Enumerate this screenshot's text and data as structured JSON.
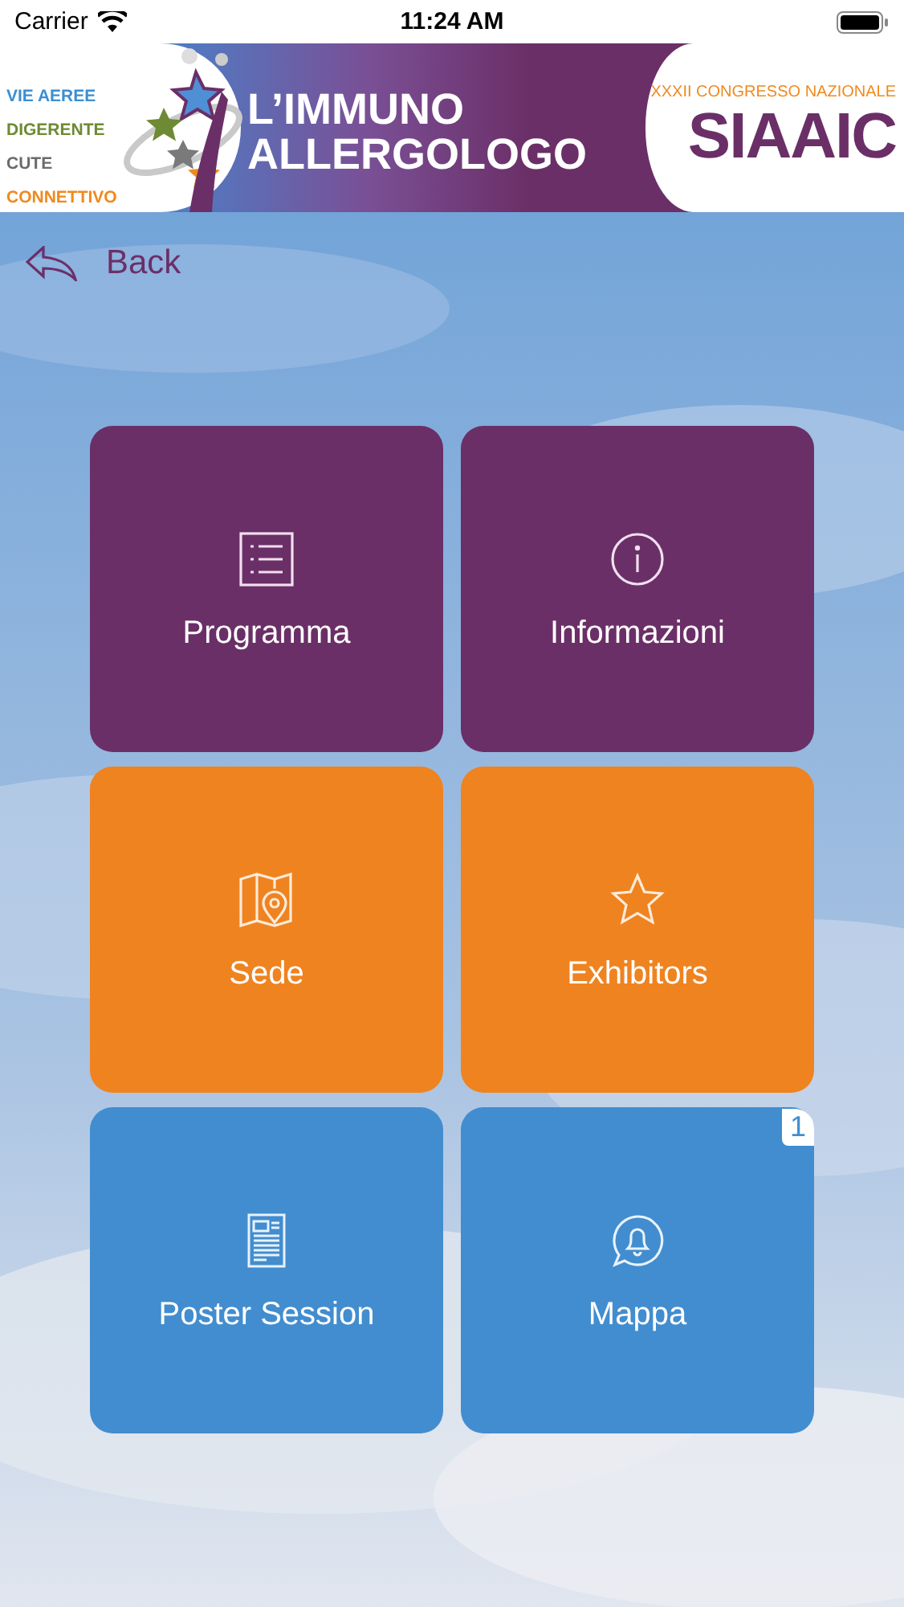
{
  "status_bar": {
    "carrier": "Carrier",
    "time": "11:24 AM"
  },
  "banner": {
    "topics": [
      {
        "label": "VIE AEREE",
        "color": "#3b8fd2"
      },
      {
        "label": "DIGERENTE",
        "color": "#6f8a34"
      },
      {
        "label": "CUTE",
        "color": "#6b6b6b"
      },
      {
        "label": "CONNETTIVO",
        "color": "#ef8a1e"
      }
    ],
    "title_lines": [
      "L’IMMUNO",
      "ALLERGOLOGO"
    ],
    "subtitle": "XXXII CONGRESSO NAZIONALE",
    "acronym": "SIAAIC"
  },
  "back": {
    "label": "Back"
  },
  "tiles": [
    {
      "label": "Programma",
      "kind": "list",
      "color": "#6b2f67"
    },
    {
      "label": "Informazioni",
      "kind": "info",
      "color": "#6b2f67"
    },
    {
      "label": "Sede",
      "kind": "map",
      "color": "#ef8320"
    },
    {
      "label": "Exhibitors",
      "kind": "star",
      "color": "#ef8320"
    },
    {
      "label": "Poster Session",
      "kind": "document",
      "color": "#428dcf"
    },
    {
      "label": "Mappa",
      "kind": "chat-bell",
      "color": "#428dcf",
      "badge": "1"
    }
  ]
}
